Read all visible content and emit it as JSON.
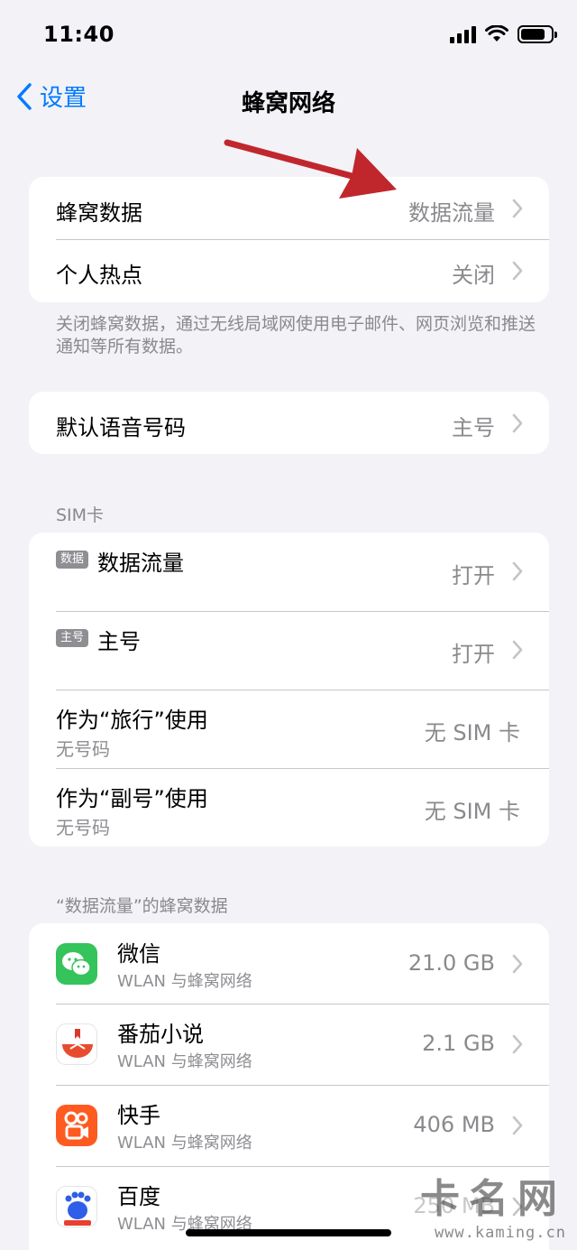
{
  "status_bar": {
    "time": "11:40"
  },
  "nav": {
    "back_label": "设置",
    "title": "蜂窝网络"
  },
  "group1": {
    "rows": [
      {
        "title": "蜂窝数据",
        "value": "数据流量"
      },
      {
        "title": "个人热点",
        "value": "关闭"
      }
    ],
    "footnote": "关闭蜂窝数据，通过无线局域网使用电子邮件、网页浏览和推送通知等所有数据。"
  },
  "group2": {
    "rows": [
      {
        "title": "默认语音号码",
        "value": "主号"
      }
    ]
  },
  "sim_section": {
    "header": "SIM卡",
    "rows": [
      {
        "badge": "数据",
        "title": "数据流量",
        "value": "打开"
      },
      {
        "badge": "主号",
        "title": "主号",
        "value": "打开"
      },
      {
        "title": "作为“旅行”使用",
        "subtitle": "无号码",
        "value": "无 SIM 卡"
      },
      {
        "title": "作为“副号”使用",
        "subtitle": "无号码",
        "value": "无 SIM 卡"
      }
    ]
  },
  "apps_section": {
    "header": "“数据流量”的蜂窝数据",
    "apps": [
      {
        "name": "微信",
        "subtitle": "WLAN 与蜂窝网络",
        "usage": "21.0 GB",
        "icon": "wechat-icon"
      },
      {
        "name": "番茄小说",
        "subtitle": "WLAN 与蜂窝网络",
        "usage": "2.1 GB",
        "icon": "fanqie-novel-icon"
      },
      {
        "name": "快手",
        "subtitle": "WLAN 与蜂窝网络",
        "usage": "406 MB",
        "icon": "kuaishou-icon"
      },
      {
        "name": "百度",
        "subtitle": "WLAN 与蜂窝网络",
        "usage": "250 MB",
        "icon": "baidu-icon"
      }
    ]
  },
  "watermark": {
    "main": "卡名网",
    "sub": "www.kaming.cn"
  },
  "colors": {
    "accent": "#007aff",
    "background": "#f2f2f7",
    "annotation_arrow": "#c0272d"
  }
}
